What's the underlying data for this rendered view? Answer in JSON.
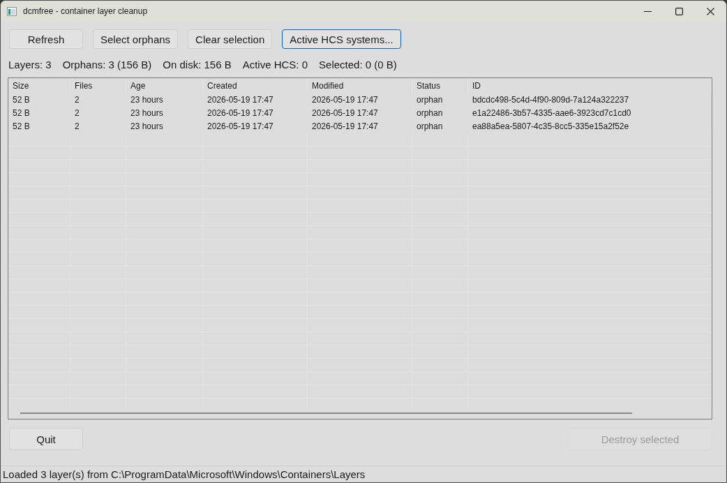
{
  "window": {
    "title": "dcmfree - container layer cleanup"
  },
  "toolbar": {
    "buttons": [
      {
        "label": "Refresh",
        "focused": false
      },
      {
        "label": "Select orphans",
        "focused": false
      },
      {
        "label": "Clear selection",
        "focused": false
      },
      {
        "label": "Active HCS systems...",
        "focused": true
      }
    ]
  },
  "summary": [
    "Layers: 3",
    "Orphans: 3 (156 B)",
    "On disk: 156 B",
    "Active HCS: 0",
    "Selected: 0 (0 B)"
  ],
  "table": {
    "columns": [
      "Size",
      "Files",
      "Age",
      "Created",
      "Modified",
      "Status",
      "ID"
    ],
    "rows": [
      {
        "selected": false,
        "cells": [
          "52 B",
          "2",
          "23 hours",
          "2026-05-19 17:47",
          "2026-05-19 17:47",
          "orphan",
          "bdcdc498-5c4d-4f90-809d-7a124a322237"
        ]
      },
      {
        "selected": false,
        "cells": [
          "52 B",
          "2",
          "23 hours",
          "2026-05-19 17:47",
          "2026-05-19 17:47",
          "orphan",
          "e1a22486-3b57-4335-aae6-3923cd7c1cd0"
        ]
      },
      {
        "selected": false,
        "cells": [
          "52 B",
          "2",
          "23 hours",
          "2026-05-19 17:47",
          "2026-05-19 17:47",
          "orphan",
          "ea88a5ea-5807-4c35-8cc5-335e15a2f52e"
        ]
      }
    ]
  },
  "footer": {
    "buttons": [
      {
        "label": "Quit",
        "disabled": false
      },
      {
        "label": "Destroy selected",
        "disabled": true
      }
    ]
  },
  "status_bar": "Loaded 3 layer(s) from C:\\ProgramData\\Microsoft\\Windows\\Containers\\Layers"
}
